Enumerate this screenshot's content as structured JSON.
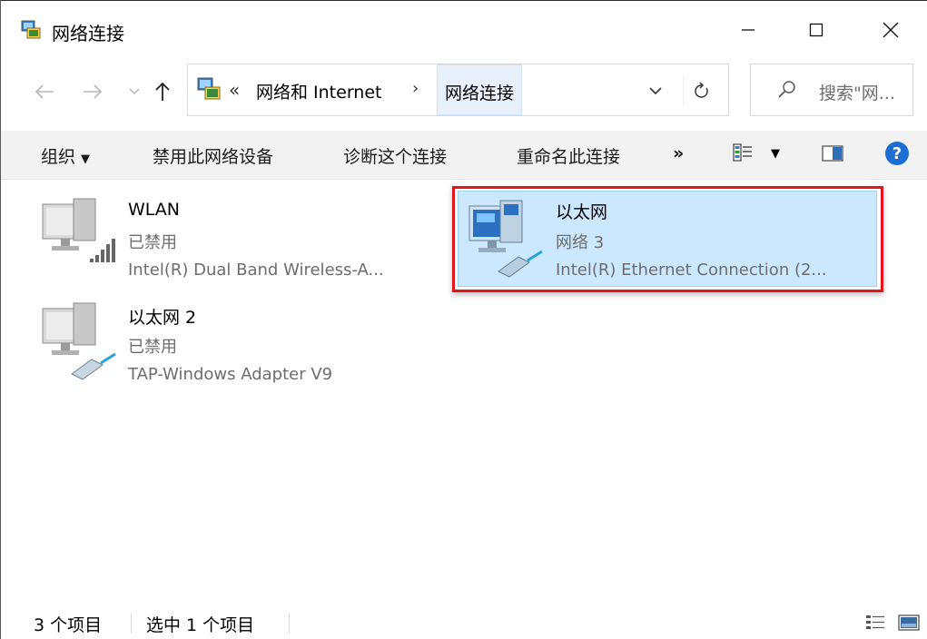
{
  "window": {
    "title": "网络连接",
    "icon": "network-connections-icon",
    "controls": {
      "minimize": "minimize-icon",
      "maximize": "maximize-icon",
      "close": "close-icon"
    }
  },
  "address_bar": {
    "overflow": "«",
    "breadcrumbs": [
      "网络和 Internet",
      "网络连接"
    ],
    "separator": "›"
  },
  "search": {
    "placeholder": "搜索\"网..."
  },
  "command_bar": {
    "organize": "组织",
    "disable": "禁用此网络设备",
    "diagnose": "诊断这个连接",
    "rename": "重命名此连接",
    "more": "»"
  },
  "items": [
    {
      "name": "WLAN",
      "status": "已禁用",
      "device": "Intel(R) Dual Band Wireless-A...",
      "icon": "wifi-adapter-icon",
      "selected": false
    },
    {
      "name": "以太网",
      "status": "网络  3",
      "device": "Intel(R) Ethernet Connection (2...",
      "icon": "ethernet-adapter-icon",
      "selected": true
    },
    {
      "name": "以太网 2",
      "status": "已禁用",
      "device": "TAP-Windows Adapter V9",
      "icon": "ethernet-adapter-icon",
      "selected": false
    }
  ],
  "status_bar": {
    "count": "3 个项目",
    "selection": "选中 1 个项目"
  },
  "colors": {
    "selection_fill": "#cce8ff",
    "selection_border": "#99d1ff",
    "highlight_box": "#e3141c",
    "help_blue": "#1c6ed2"
  }
}
